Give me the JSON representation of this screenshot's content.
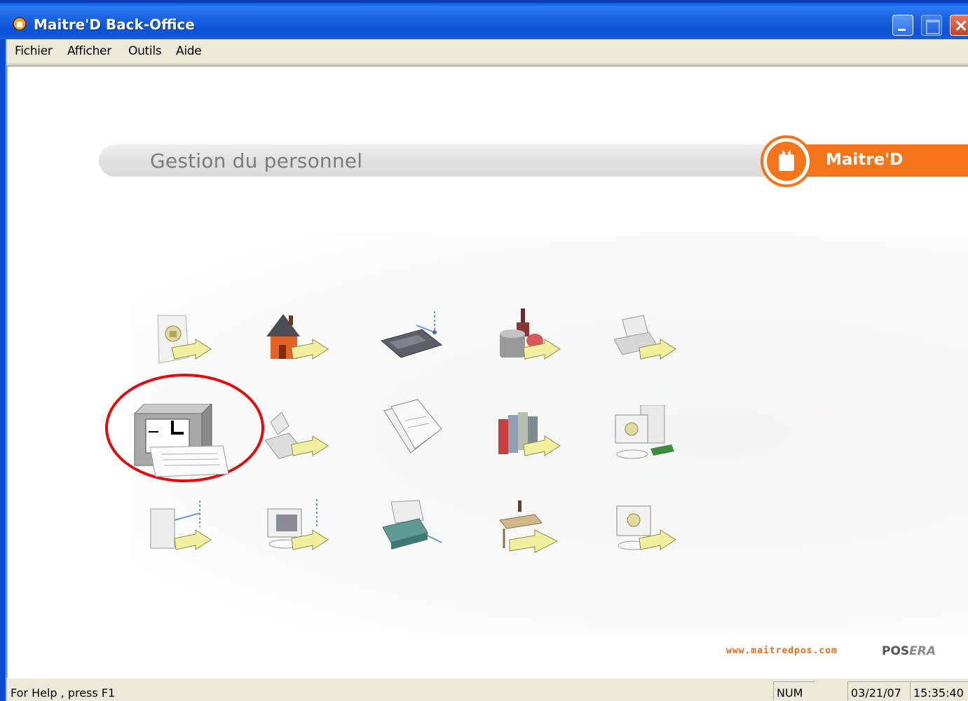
{
  "window": {
    "title": "Maitre'D Back-Office"
  },
  "menu": {
    "items": [
      "Fichier",
      "Afficher",
      "Outils",
      "Aide"
    ]
  },
  "header": {
    "section_title": "Gestion du personnel",
    "logo_text": "Maitre'D",
    "accent_color": "#f5741a"
  },
  "icons": {
    "row1": [
      "certificate-export-icon",
      "house-export-icon",
      "calculator-export-icon",
      "wine-export-icon",
      "printer-export-icon"
    ],
    "row2": [
      "time-clock-icon",
      "scanner-export-icon",
      "documents-icon",
      "binders-export-icon",
      "computer-export-icon"
    ],
    "row3": [
      "server-export-icon",
      "terminal-export-icon",
      "device-export-icon",
      "table-export-icon",
      "monitor-export-icon"
    ],
    "highlighted": "time-clock-icon",
    "highlight_color": "#e00d0d"
  },
  "footer": {
    "url": "www.maitredpos.com",
    "brand_pos": "POS",
    "brand_era": "ERA"
  },
  "status": {
    "help_text": "For Help , press F1",
    "num": "NUM",
    "date": "03/21/07",
    "time": "15:35:40"
  }
}
